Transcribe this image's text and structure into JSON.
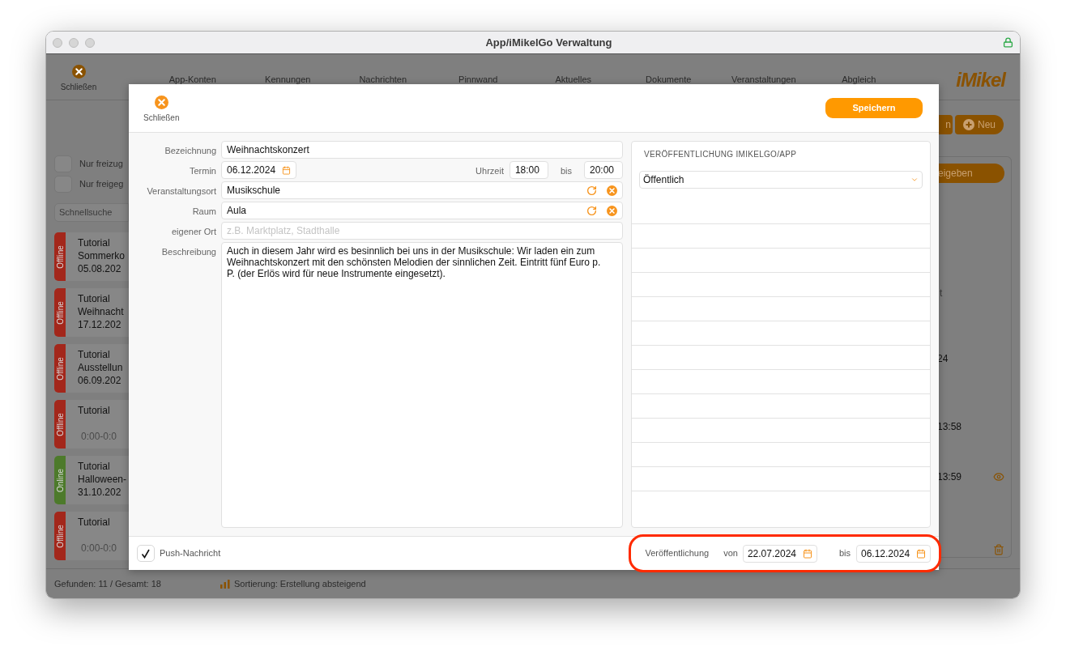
{
  "window": {
    "title": "App/iMikelGo Verwaltung"
  },
  "toolbar": {
    "close_label": "Schließen",
    "nav": [
      "App-Konten",
      "Kennungen",
      "Nachrichten",
      "Pinnwand",
      "Aktuelles",
      "Dokumente",
      "Veranstaltungen",
      "Abgleich"
    ],
    "logo": "iMikel"
  },
  "sidebar": {
    "filters": [
      {
        "label": "Nur freizug",
        "checked": false
      },
      {
        "label": "Nur freigeg",
        "checked": false
      }
    ],
    "search": {
      "placeholder": "Schnellsuche"
    },
    "items": [
      {
        "status": "Offline",
        "color": "#a3271b",
        "lines": [
          "Tutorial",
          "Sommerko",
          "05.08.202"
        ]
      },
      {
        "status": "Offline",
        "color": "#a3271b",
        "lines": [
          "Tutorial",
          "Weihnacht",
          "17.12.202"
        ]
      },
      {
        "status": "Offline",
        "color": "#a3271b",
        "lines": [
          "Tutorial",
          "Ausstellun",
          "06.09.202"
        ]
      },
      {
        "status": "Offline",
        "color": "#a3271b",
        "lines": [
          "Tutorial"
        ],
        "time": "0:00-0:0"
      },
      {
        "status": "Online",
        "color": "#4d7a2b",
        "lines": [
          "Tutorial",
          "Halloween-",
          "31.10.202"
        ]
      },
      {
        "status": "Offline",
        "color": "#a3271b",
        "lines": [
          "Tutorial"
        ],
        "time": "0:00-0:0"
      }
    ]
  },
  "right_strip": {
    "buttons": [
      "n",
      "Neu"
    ],
    "release_button": "eigeben",
    "fragments": [
      "t",
      "24",
      "13:58",
      "13:59"
    ]
  },
  "status_bar": {
    "found": "Gefunden: 11 / Gesamt: 18",
    "sort": "Sortierung: Erstellung absteigend"
  },
  "dialog": {
    "close_label": "Schließen",
    "save": "Speichern",
    "fields": [
      {
        "kind": "text",
        "label": "Bezeichnung",
        "value": "Weihnachtskonzert"
      },
      {
        "kind": "date_time",
        "label": "Termin",
        "value": "06.12.2024",
        "time_label": "Uhrzeit",
        "from": "18:00",
        "to_label": "bis",
        "to": "20:00"
      },
      {
        "kind": "lookup",
        "label": "Veranstaltungsort",
        "value": "Musikschule"
      },
      {
        "kind": "lookup",
        "label": "Raum",
        "value": "Aula"
      },
      {
        "kind": "text",
        "label": "eigener Ort",
        "placeholder": "z.B. Marktplatz, Stadthalle"
      },
      {
        "kind": "textarea",
        "label": "Beschreibung",
        "value": "Auch in diesem Jahr wird es besinnlich bei uns in der Musikschule: Wir laden ein zum Weihnachtskonzert mit den schönsten Melodien der sinnlichen Zeit. Eintritt fünf Euro p. P. (der Erlös wird für neue Instrumente eingesetzt)."
      }
    ],
    "publication": {
      "header": "VERÖFFENTLICHUNG IMIKELGO/APP",
      "select": "Öffentlich"
    },
    "push": {
      "label": "Push-Nachricht",
      "checked": true
    },
    "period": {
      "label": "Veröffentlichung",
      "from_label": "von",
      "from": "22.07.2024",
      "to_label": "bis",
      "to": "06.12.2024"
    }
  }
}
